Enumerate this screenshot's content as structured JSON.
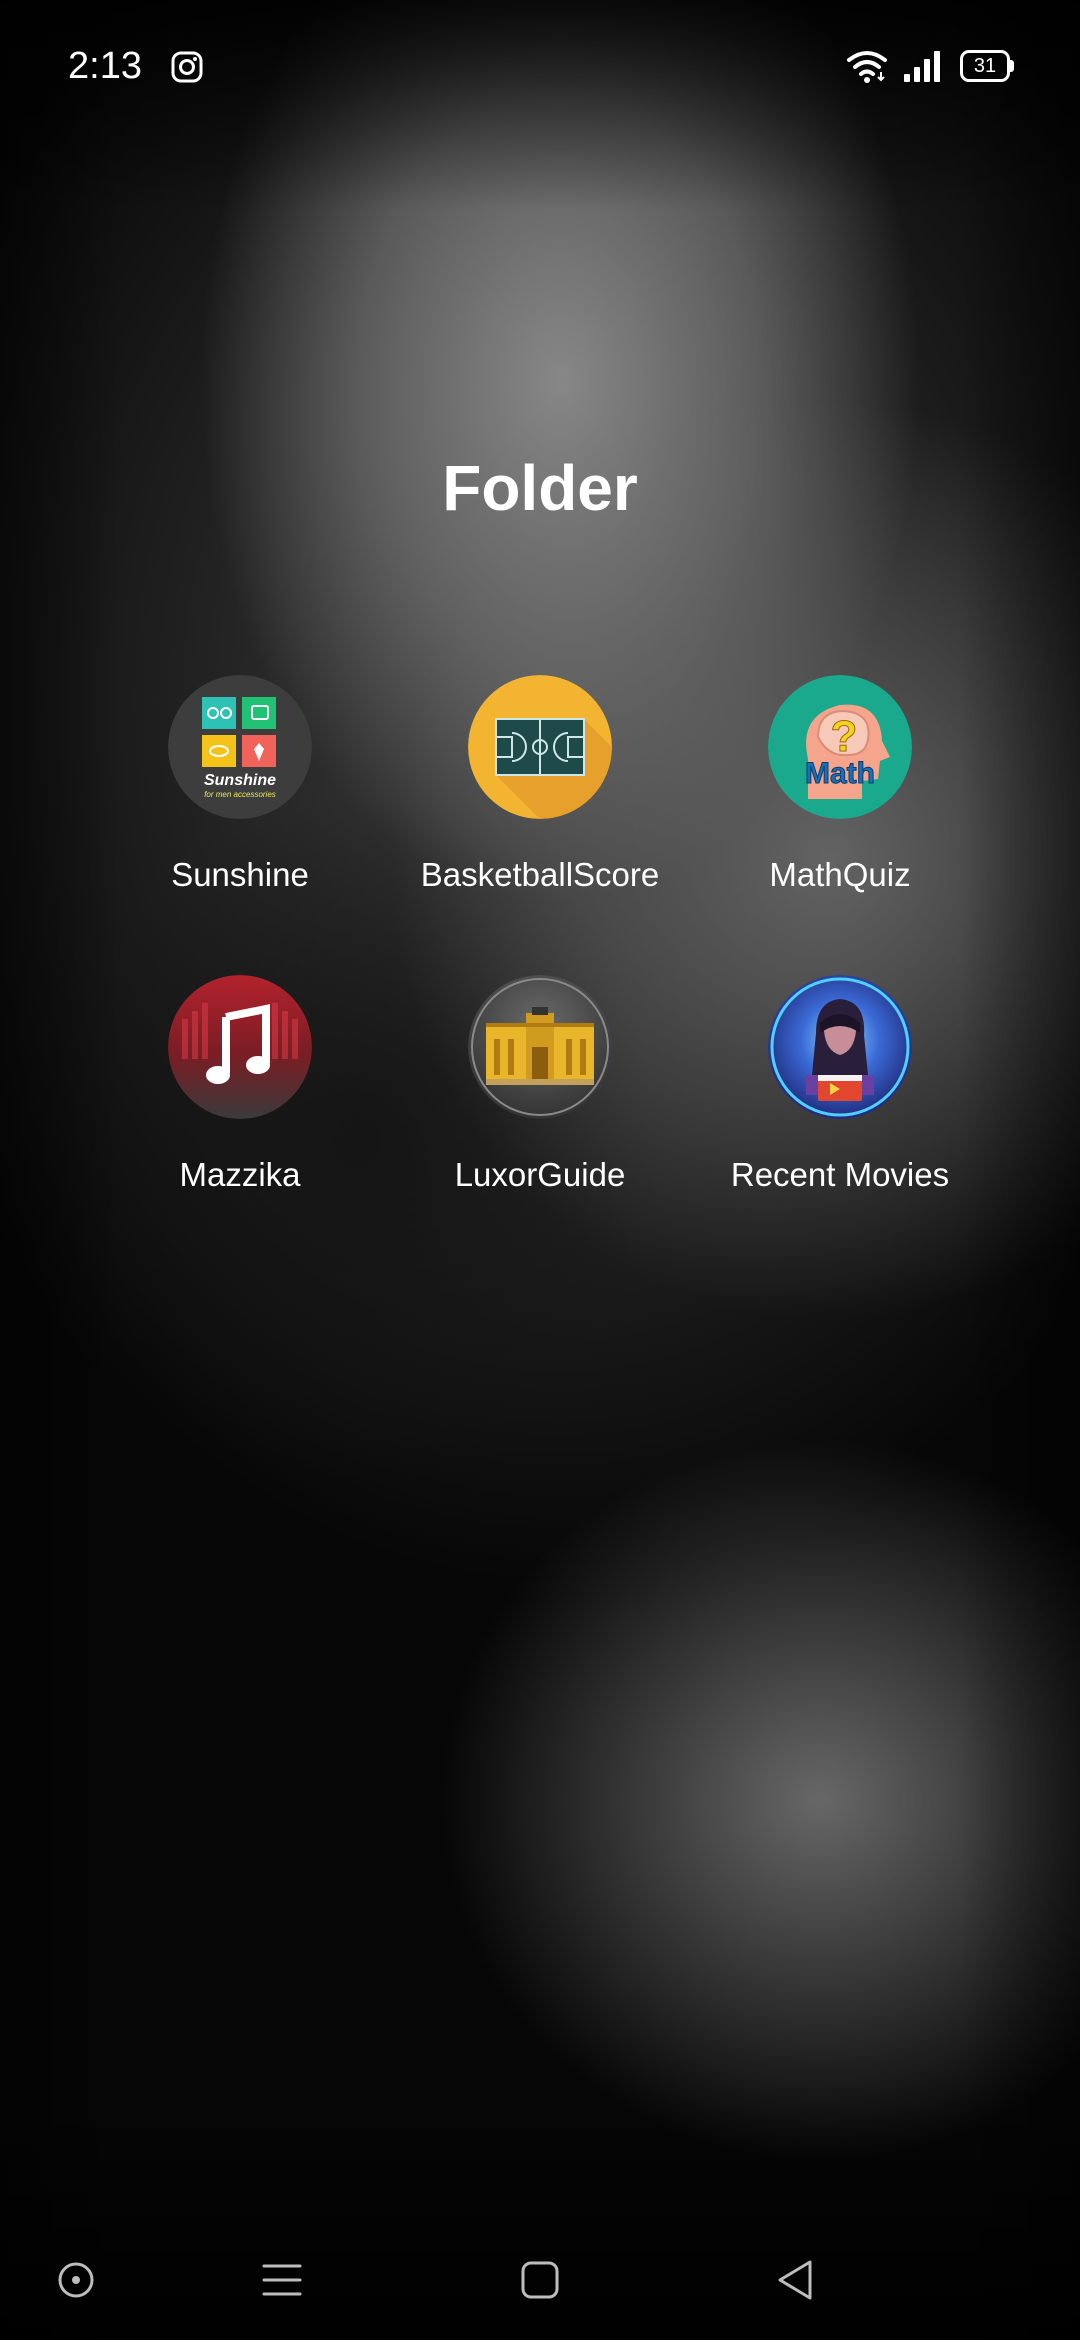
{
  "status_bar": {
    "time": "2:13",
    "notification_icons": [
      "instagram-icon"
    ],
    "system_icons": [
      "wifi-icon",
      "signal-icon",
      "battery-icon"
    ],
    "battery_level": "31"
  },
  "folder": {
    "title": "Folder",
    "apps": [
      {
        "label": "Sunshine",
        "icon": "sunshine-app-icon",
        "icon_text": "Sunshine",
        "icon_subtext": "for men accessories"
      },
      {
        "label": "BasketballScore",
        "icon": "basketball-court-icon"
      },
      {
        "label": "MathQuiz",
        "icon": "math-head-icon",
        "icon_text": "Math"
      },
      {
        "label": "Mazzika",
        "icon": "music-note-icon"
      },
      {
        "label": "LuxorGuide",
        "icon": "temple-icon"
      },
      {
        "label": "Recent Movies",
        "icon": "movie-poster-icon"
      }
    ]
  },
  "nav_bar": {
    "buttons": [
      "assistant-button",
      "menu-button",
      "home-button",
      "back-button"
    ]
  },
  "colors": {
    "text": "#ffffff",
    "sunshine_bg": "#3d3d3d",
    "basketball_bg": "#f3b531",
    "math_bg": "#1ba98e",
    "mazzika_bg": "#4a2326",
    "luxor_bg": "#4a4a4a",
    "movies_bg": "#2a2f8a"
  }
}
